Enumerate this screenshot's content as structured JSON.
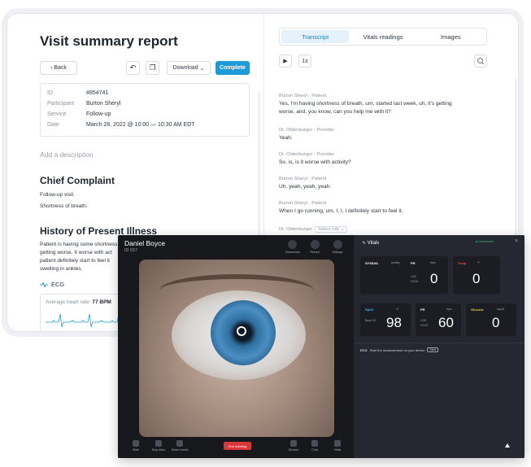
{
  "report": {
    "title": "Visit summary report",
    "toolbar": {
      "back_label": "Back",
      "download_label": "Download",
      "complete_label": "Complete"
    },
    "meta": [
      {
        "key": "ID",
        "value": "#854741"
      },
      {
        "key": "Participant",
        "value": "Burton Sheryl"
      },
      {
        "key": "Service",
        "value": "Follow-up"
      },
      {
        "key": "Date",
        "value": "March 28, 2022 @ 10:00 — 10:30 AM EDT"
      }
    ],
    "description_placeholder": "Add a description",
    "chief_complaint": {
      "heading": "Chief Complaint",
      "lines": [
        "Follow-up visit.",
        "Shortness of breath."
      ]
    },
    "hpi": {
      "heading": "History of Present Illness",
      "lines": [
        "Patient is having some shortness",
        "getting worse. It worse with act",
        "patient definitely start to feel it",
        "swelling in ankles."
      ]
    },
    "ecg": {
      "label": "ECG",
      "hr_label": "Average heart rate:",
      "hr_value": "77 BPM"
    }
  },
  "transcript": {
    "tabs": [
      "Transcript",
      "Vitals readings",
      "Images"
    ],
    "speed_label": "1x",
    "messages": [
      {
        "speaker": "Burton Sheryl",
        "role": "Patient",
        "text": "Yes, I'm having shortness of breath, um, started last week, uh, it's getting worse, and, you know, can you help me with it?"
      },
      {
        "speaker": "Dr. Oldenburger",
        "role": "Provider",
        "text": "Yeah."
      },
      {
        "speaker": "Dr. Oldenburger",
        "role": "Provider",
        "text": "So, is, is it worse with activity?"
      },
      {
        "speaker": "Burton Sheryl",
        "role": "Patient",
        "text": "Uh, yeah, yeah, yeah."
      },
      {
        "speaker": "Burton Sheryl",
        "role": "Patient",
        "text": "When I go running, um, I, I, I definitely start to feel it."
      },
      {
        "speaker": "Dr. Oldenburger",
        "role": "Select role",
        "text": ""
      }
    ]
  },
  "call": {
    "caller_name": "Daniel Boyce",
    "caller_id": "ID 557",
    "top_buttons": [
      "Screenshot",
      "Record",
      "Settings"
    ],
    "bottom_buttons": [
      "Mute",
      "Stop video",
      "Share screen"
    ],
    "end_label": "End meeting",
    "right_buttons": [
      "Devices",
      "Chat",
      "Vitals"
    ]
  },
  "vitals": {
    "title": "Vitals",
    "status": "Connected",
    "cards": [
      {
        "label": "SYS/DIA",
        "label2": "mmHg",
        "label3": "PR",
        "unit": "bpm",
        "value": "0",
        "sub": "L/20\nH/120",
        "color": "#ffffff"
      },
      {
        "label": "Temp",
        "unit": "°F",
        "value": "0",
        "color": "#e74c3c"
      },
      {
        "label": "SpO2",
        "unit": "%",
        "value": "98",
        "sub": "Basic 90",
        "color": "#3fb6e8"
      },
      {
        "label": "PR",
        "unit": "bpm",
        "value": "60",
        "sub": "L/30\nH/120",
        "color": "#ffffff"
      },
      {
        "label": "Glucose",
        "unit": "mg/dL",
        "value": "0",
        "color": "#e8d23f"
      }
    ],
    "ecg_label": "ECG",
    "ecg_hint": "Start the measurement on your device",
    "ecg_start": "Start"
  }
}
